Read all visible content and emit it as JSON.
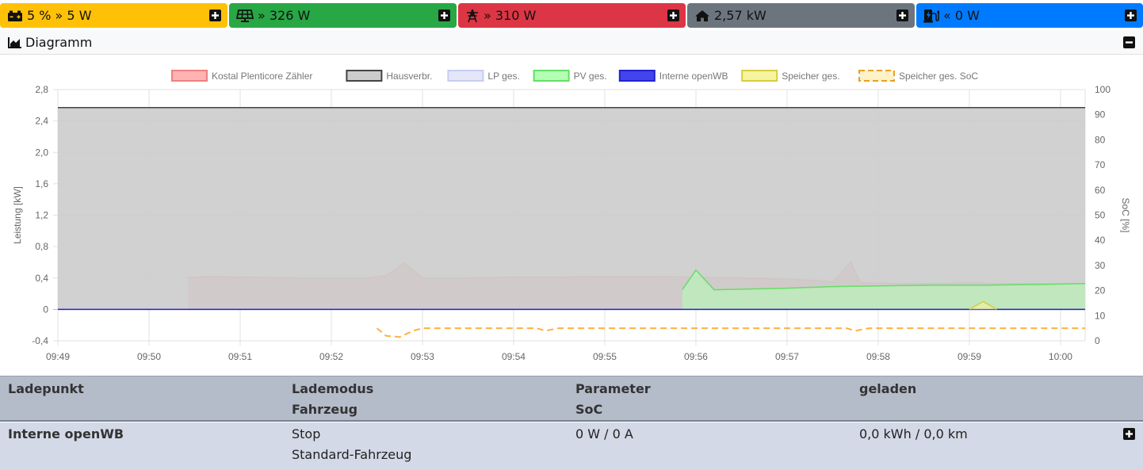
{
  "status_tiles": [
    {
      "id": "battery",
      "text": "5 % » 5 W",
      "color": "#ffc107",
      "icon": "car-battery-icon"
    },
    {
      "id": "pv",
      "text": "» 326 W",
      "color": "#28a745",
      "icon": "solar-panel-icon"
    },
    {
      "id": "grid",
      "text": "» 310 W",
      "color": "#dc3545",
      "icon": "power-tower-icon"
    },
    {
      "id": "house",
      "text": "2,57 kW",
      "color": "#6c757d",
      "icon": "home-icon"
    },
    {
      "id": "charge",
      "text": "« 0 W",
      "color": "#007bff",
      "icon": "charging-station-icon"
    }
  ],
  "diagram": {
    "title": "Diagramm"
  },
  "chart_data": {
    "type": "area",
    "legend_position": "top",
    "ylabel": "Leistung [kW]",
    "y2label": "SoC [%]",
    "ylim": [
      -0.4,
      2.8
    ],
    "y2lim": [
      0,
      100
    ],
    "yticks": [
      "2,8",
      "2,4",
      "2,0",
      "1,6",
      "1,2",
      "0,8",
      "0,4",
      "0",
      "-0,4"
    ],
    "y2ticks": [
      "100",
      "90",
      "80",
      "70",
      "60",
      "50",
      "40",
      "30",
      "20",
      "10",
      "0"
    ],
    "xticks": [
      "09:49",
      "09:50",
      "09:51",
      "09:52",
      "09:53",
      "09:54",
      "09:55",
      "09:56",
      "09:57",
      "09:58",
      "09:59",
      "10:00"
    ],
    "xrange_min": [
      49.0,
      60.27
    ],
    "series": [
      {
        "name": "Kostal Plenticore Zähler",
        "color": "#f08080",
        "fill": "#ffb3b3",
        "x": [
          50.43,
          50.6,
          51.0,
          51.2,
          51.6,
          51.8,
          52.0,
          52.4,
          52.6,
          52.8,
          53.0,
          53.5,
          53.9,
          54.5,
          55.0,
          55.5,
          56.0,
          56.5,
          56.9,
          57.3,
          57.5,
          57.7,
          57.8,
          58.3,
          58.7,
          59.0,
          59.3,
          59.7,
          60.27
        ],
        "y": [
          0.4,
          0.42,
          0.41,
          0.41,
          0.4,
          0.4,
          0.4,
          0.4,
          0.43,
          0.59,
          0.4,
          0.4,
          0.41,
          0.41,
          0.42,
          0.42,
          0.41,
          0.4,
          0.39,
          0.37,
          0.35,
          0.6,
          0.34,
          0.33,
          0.33,
          0.34,
          0.33,
          0.33,
          0.32
        ]
      },
      {
        "name": "Hausverbr.",
        "color": "#444444",
        "fill": "#cccccc",
        "x": [
          49.0,
          60.27
        ],
        "y": [
          2.57,
          2.57
        ]
      },
      {
        "name": "LP ges.",
        "color": "#c8ccf0",
        "fill": "#e4e6fa",
        "x": [
          49.0,
          60.27
        ],
        "y": [
          0,
          0
        ]
      },
      {
        "name": "PV ges.",
        "color": "#66dd66",
        "fill": "#b3ffb3",
        "x": [
          55.85,
          56.0,
          56.2,
          56.6,
          57.0,
          57.5,
          58.0,
          58.6,
          59.2,
          59.8,
          60.27
        ],
        "y": [
          0.25,
          0.5,
          0.25,
          0.26,
          0.27,
          0.29,
          0.3,
          0.31,
          0.31,
          0.32,
          0.33
        ]
      },
      {
        "name": "Interne openWB",
        "color": "#2222cc",
        "fill": "#4444ee",
        "x": [
          49.0,
          60.27
        ],
        "y": [
          0,
          0
        ]
      },
      {
        "name": "Speicher ges.",
        "color": "#d8cc40",
        "fill": "#f5f5a0",
        "x": [
          59.0,
          59.15,
          59.3
        ],
        "y": [
          0,
          0.1,
          0
        ]
      },
      {
        "name": "Speicher ges. SoC",
        "color": "#ffb040",
        "dashed": true,
        "axis": "right",
        "x": [
          52.5,
          52.6,
          52.75,
          52.9,
          53.0,
          54.25,
          54.35,
          54.5,
          57.65,
          57.75,
          57.9,
          60.27
        ],
        "y": [
          5,
          2,
          1.5,
          4,
          5,
          5,
          4,
          5,
          5,
          4,
          5,
          5
        ]
      }
    ]
  },
  "table": {
    "headers": [
      {
        "line1": "Ladepunkt",
        "line2": ""
      },
      {
        "line1": "Lademodus",
        "line2": "Fahrzeug"
      },
      {
        "line1": "Parameter",
        "line2": "SoC"
      },
      {
        "line1": "geladen",
        "line2": ""
      }
    ],
    "rows": [
      {
        "name": "Interne openWB",
        "mode": "Stop",
        "vehicle": "Standard-Fahrzeug",
        "params": "0 W / 0 A",
        "charged": "0,0 kWh / 0,0 km"
      }
    ]
  }
}
